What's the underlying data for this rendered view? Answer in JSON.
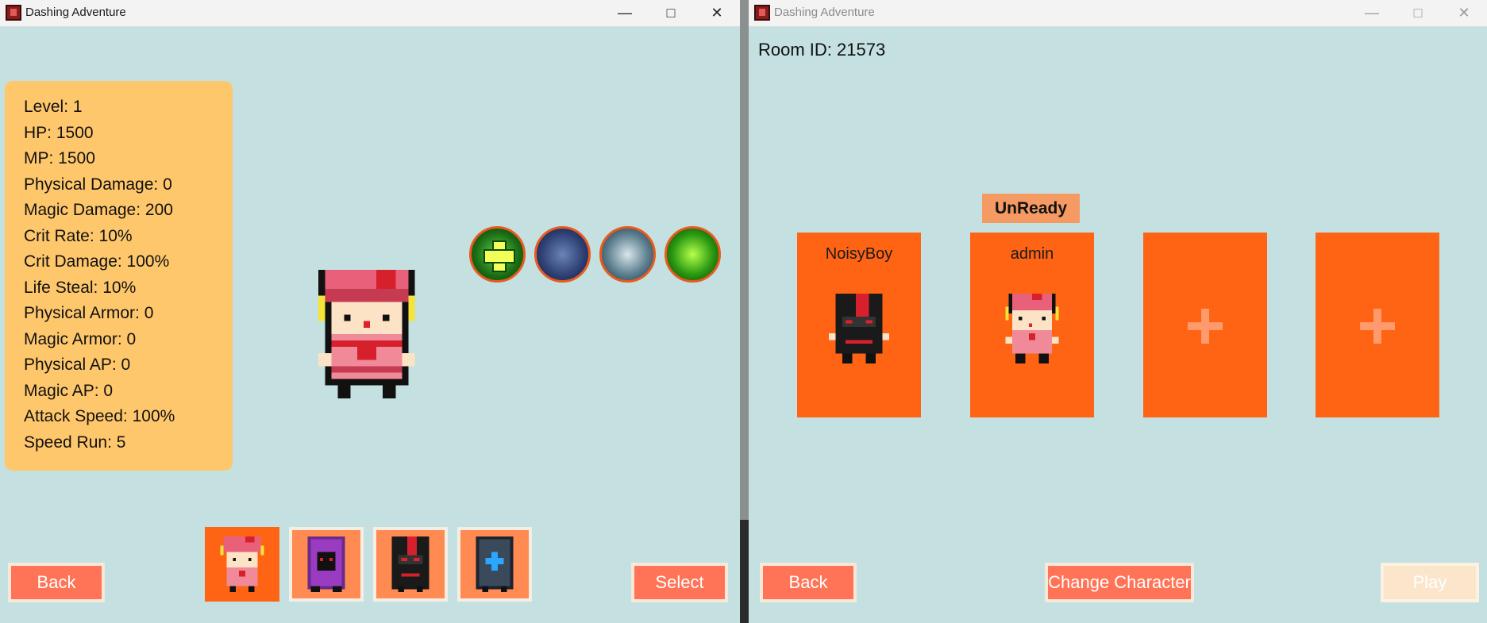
{
  "left_window": {
    "title": "Dashing Adventure",
    "stats": [
      "Level: 1",
      "HP: 1500",
      "MP: 1500",
      "Physical Damage: 0",
      "Magic Damage: 200",
      "Crit Rate: 10%",
      "Crit Damage: 100%",
      "Life Steal: 10%",
      "Physical Armor: 0",
      "Magic Armor: 0",
      "Physical AP: 0",
      "Magic AP: 0",
      "Attack Speed: 100%",
      "Speed Run: 5"
    ],
    "skills": [
      "heal-skill-icon",
      "water-spirit-skill-icon",
      "guardian-skill-icon",
      "shadow-aura-skill-icon"
    ],
    "characters": [
      "pink-beret-girl-icon",
      "purple-hooded-mage-icon",
      "black-ninja-icon",
      "blue-armored-knight-icon"
    ],
    "selected_character_index": 0,
    "back_label": "Back",
    "select_label": "Select"
  },
  "right_window": {
    "title": "Dashing Adventure",
    "room_id": "Room ID: 21573",
    "ready_status": "UnReady",
    "players": [
      {
        "name": "NoisyBoy",
        "avatar": "black-ninja-icon"
      },
      {
        "name": "admin",
        "avatar": "pink-beret-girl-icon"
      },
      {
        "name": "",
        "avatar": "add-player-icon"
      },
      {
        "name": "",
        "avatar": "add-player-icon"
      }
    ],
    "back_label": "Back",
    "change_character_label": "Change Character",
    "play_label": "Play"
  },
  "colors": {
    "background": "#c4e0e0",
    "stats_panel": "#ffc76b",
    "accent_orange": "#ff6414",
    "button": "#ff7456",
    "disabled_button": "#fbe6cc"
  }
}
